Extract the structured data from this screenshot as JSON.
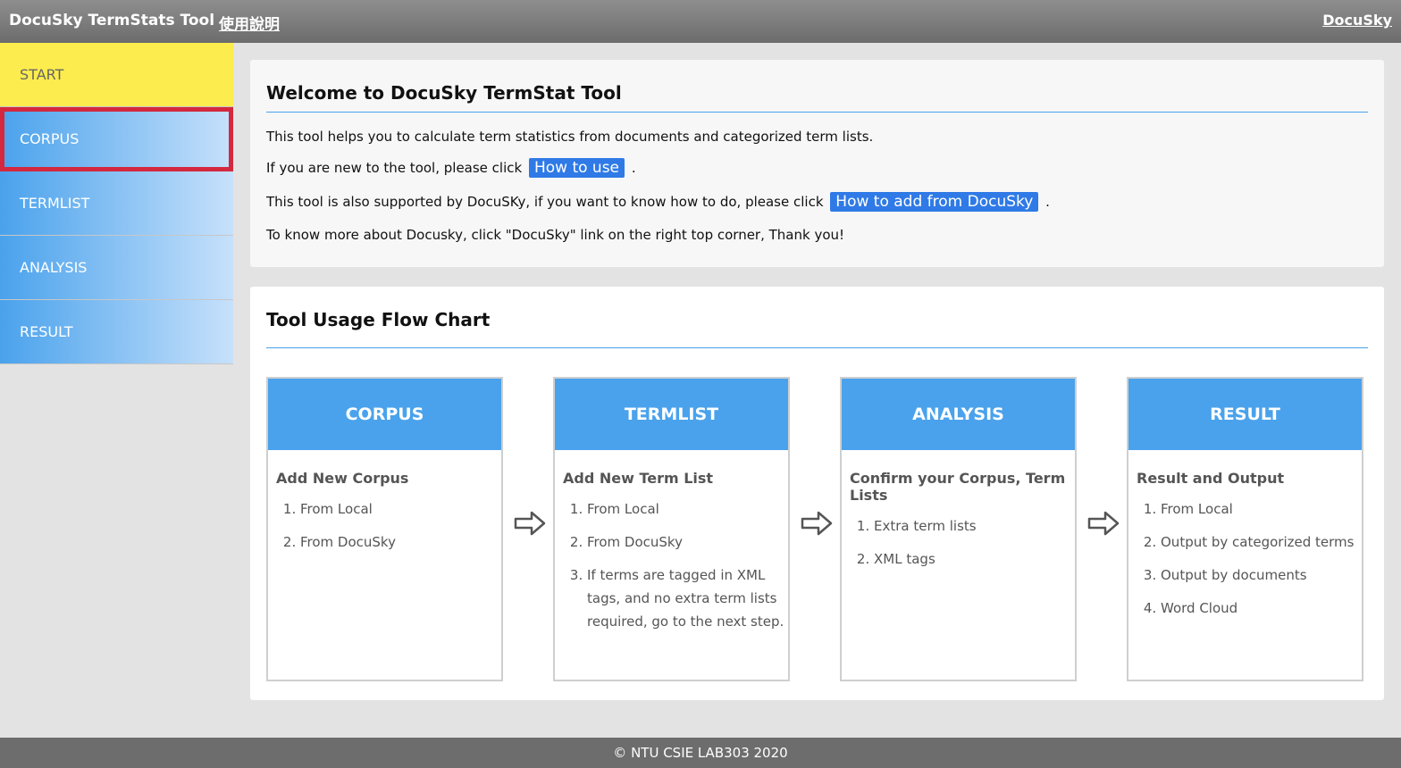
{
  "header": {
    "title": "DocuSky TermStats Tool",
    "help_link": "使用說明",
    "docusky_link": "DocuSky"
  },
  "sidebar": {
    "items": [
      {
        "label": "START"
      },
      {
        "label": "CORPUS"
      },
      {
        "label": "TERMLIST"
      },
      {
        "label": "ANALYSIS"
      },
      {
        "label": "RESULT"
      }
    ],
    "active": "START",
    "highlighted": "CORPUS"
  },
  "welcome": {
    "title": "Welcome to DocuSky TermStat Tool",
    "line1": "This tool helps you to calculate term statistics from documents and categorized term lists.",
    "line2_pre": "If you are new to the tool, please click",
    "line2_button": "How to use",
    "line2_post": ".",
    "line3_pre": "This tool is also supported by DocuSKy, if you want to know how to do, please click",
    "line3_button": "How to add from DocuSky",
    "line3_post": ".",
    "line4": "To know more about Docusky, click \"DocuSky\" link on the right top corner, Thank you!"
  },
  "flow": {
    "title": "Tool Usage Flow Chart",
    "steps": [
      {
        "header": "CORPUS",
        "subtitle": "Add New Corpus",
        "items": [
          "From Local",
          "From DocuSky"
        ]
      },
      {
        "header": "TERMLIST",
        "subtitle": "Add New Term List",
        "items": [
          "From Local",
          "From DocuSky",
          "If terms are tagged in XML tags, and no extra term lists required, go to the next step."
        ]
      },
      {
        "header": "ANALYSIS",
        "subtitle": "Confirm your Corpus, Term Lists",
        "items": [
          "Extra term lists",
          "XML tags"
        ]
      },
      {
        "header": "RESULT",
        "subtitle": "Result and Output",
        "items": [
          "From Local",
          "Output by categorized terms",
          "Output by documents",
          "Word Cloud"
        ]
      }
    ]
  },
  "footer": {
    "text": "© NTU CSIE LAB303 2020"
  },
  "colors": {
    "accent": "#4aa2ec",
    "start_yellow": "#fdec4d",
    "highlight_red": "#d3283e",
    "button_blue": "#2f7ae6"
  }
}
